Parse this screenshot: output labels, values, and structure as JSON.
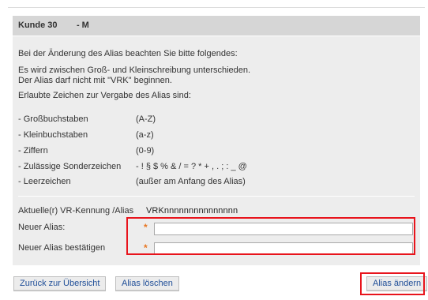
{
  "header": {
    "title": "Kunde 30        - M"
  },
  "info": {
    "intro": "Bei der Änderung des Alias beachten Sie bitte folgendes:",
    "rule_case": "Es wird zwischen Groß- und Kleinschreibung unterschieden.",
    "rule_prefix": "Der Alias darf nicht mit \"VRK\" beginnen.",
    "allowed_title": "Erlaubte Zeichen zur Vergabe des Alias sind:"
  },
  "allowed_chars": [
    {
      "label": "- Großbuchstaben",
      "value": "(A-Z)"
    },
    {
      "label": "- Kleinbuchstaben",
      "value": "(a-z)"
    },
    {
      "label": "- Ziffern",
      "value": "(0-9)"
    },
    {
      "label": "- Zulässige Sonderzeichen",
      "value": "- ! § $ % & / = ? * + , . ; : _ @"
    },
    {
      "label": "- Leerzeichen",
      "value": "(außer am Anfang des Alias)"
    }
  ],
  "form": {
    "current_label": "Aktuelle(r) VR-Kennung /Alias",
    "current_value": "VRKnnnnnnnnnnnnnnn",
    "new_alias_label": "Neuer Alias:",
    "new_alias_value": "",
    "confirm_label": "Neuer Alias bestätigen",
    "confirm_value": "",
    "required_marker": "*"
  },
  "buttons": {
    "back": "Zurück zur Übersicht",
    "delete": "Alias löschen",
    "change": "Alias ändern"
  },
  "colors": {
    "highlight": "#e8141c",
    "required": "#e87722",
    "button_text": "#1f4e98",
    "panel_bg": "#ededed",
    "header_bg": "#d6d6d6"
  }
}
